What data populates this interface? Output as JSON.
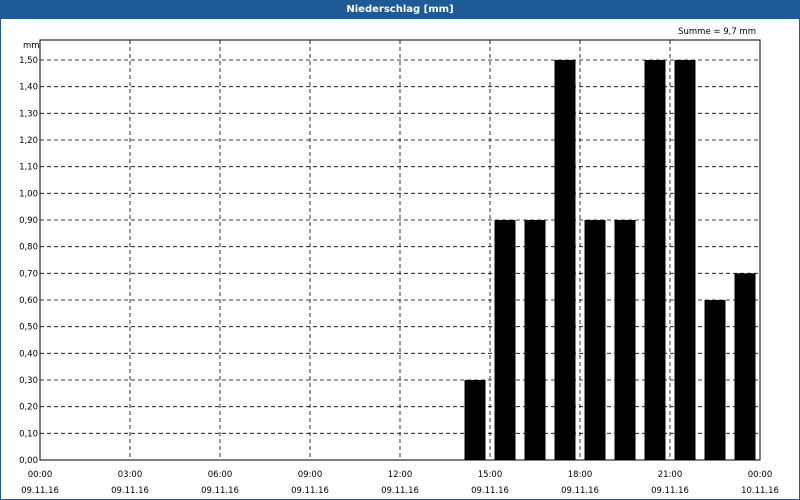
{
  "window": {
    "title": "Niederschlag [mm]"
  },
  "chart_data": {
    "type": "bar",
    "title": "Niederschlag [mm]",
    "unit_label": "mm",
    "sum_label": "Summe = 9,7 mm",
    "y_ticks": [
      "0,00",
      "0,10",
      "0,20",
      "0,30",
      "0,40",
      "0,50",
      "0,60",
      "0,70",
      "0,80",
      "0,90",
      "1,00",
      "1,10",
      "1,20",
      "1,30",
      "1,40",
      "1,50"
    ],
    "ylim": [
      0,
      1.5
    ],
    "xlim_hours": [
      0,
      24
    ],
    "x_ticks": [
      {
        "time": "00:00",
        "date": "09.11.16"
      },
      {
        "time": "03:00",
        "date": "09.11.16"
      },
      {
        "time": "06:00",
        "date": "09.11.16"
      },
      {
        "time": "09:00",
        "date": "09.11.16"
      },
      {
        "time": "12:00",
        "date": "09.11.16"
      },
      {
        "time": "15:00",
        "date": "09.11.16"
      },
      {
        "time": "18:00",
        "date": "09.11.16"
      },
      {
        "time": "21:00",
        "date": "09.11.16"
      },
      {
        "time": "00:00",
        "date": "10.11.16"
      }
    ],
    "bars": [
      {
        "hour": 14,
        "value": 0.3
      },
      {
        "hour": 15,
        "value": 0.9
      },
      {
        "hour": 16,
        "value": 0.9
      },
      {
        "hour": 17,
        "value": 1.5
      },
      {
        "hour": 18,
        "value": 0.9
      },
      {
        "hour": 19,
        "value": 0.9
      },
      {
        "hour": 20,
        "value": 1.5
      },
      {
        "hour": 21,
        "value": 1.5
      },
      {
        "hour": 22,
        "value": 0.6
      },
      {
        "hour": 23,
        "value": 0.7
      }
    ],
    "grid": true,
    "bar_color": "#000000"
  },
  "colors": {
    "titlebar": "#1e5a96",
    "bars": "#000000"
  }
}
